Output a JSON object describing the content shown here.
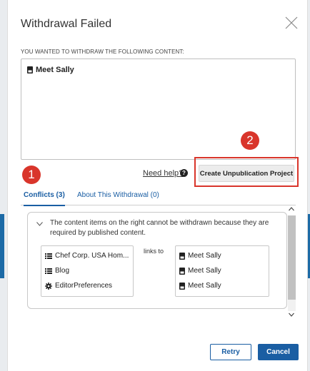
{
  "dialog": {
    "title": "Withdrawal Failed",
    "instructions": "YOU WANTED TO WITHDRAW THE FOLLOWING CONTENT:",
    "content_items": [
      {
        "label": "Meet Sally",
        "icon": "document-icon"
      }
    ],
    "need_help": "Need help?",
    "create_button": "Create Unpublication Project"
  },
  "tabs": [
    {
      "label": "Conflicts (3)",
      "active": true
    },
    {
      "label": "About This Withdrawal (0)",
      "active": false
    }
  ],
  "conflicts": {
    "message": "The content items on the right cannot be withdrawn because they are required by published content.",
    "links_to": "links to",
    "sources": [
      {
        "label": "Chef Corp. USA Hom...",
        "icon": "list-icon"
      },
      {
        "label": "Blog",
        "icon": "list-icon"
      },
      {
        "label": "EditorPreferences",
        "icon": "gear-icon"
      }
    ],
    "targets": [
      {
        "label": "Meet Sally",
        "icon": "document-icon"
      },
      {
        "label": "Meet Sally",
        "icon": "document-icon"
      },
      {
        "label": "Meet Sally",
        "icon": "document-icon"
      }
    ]
  },
  "callouts": {
    "first": "1",
    "second": "2"
  },
  "footer": {
    "retry": "Retry",
    "cancel": "Cancel"
  },
  "colors": {
    "accent": "#1a5ea3",
    "callout": "#d9352b"
  }
}
